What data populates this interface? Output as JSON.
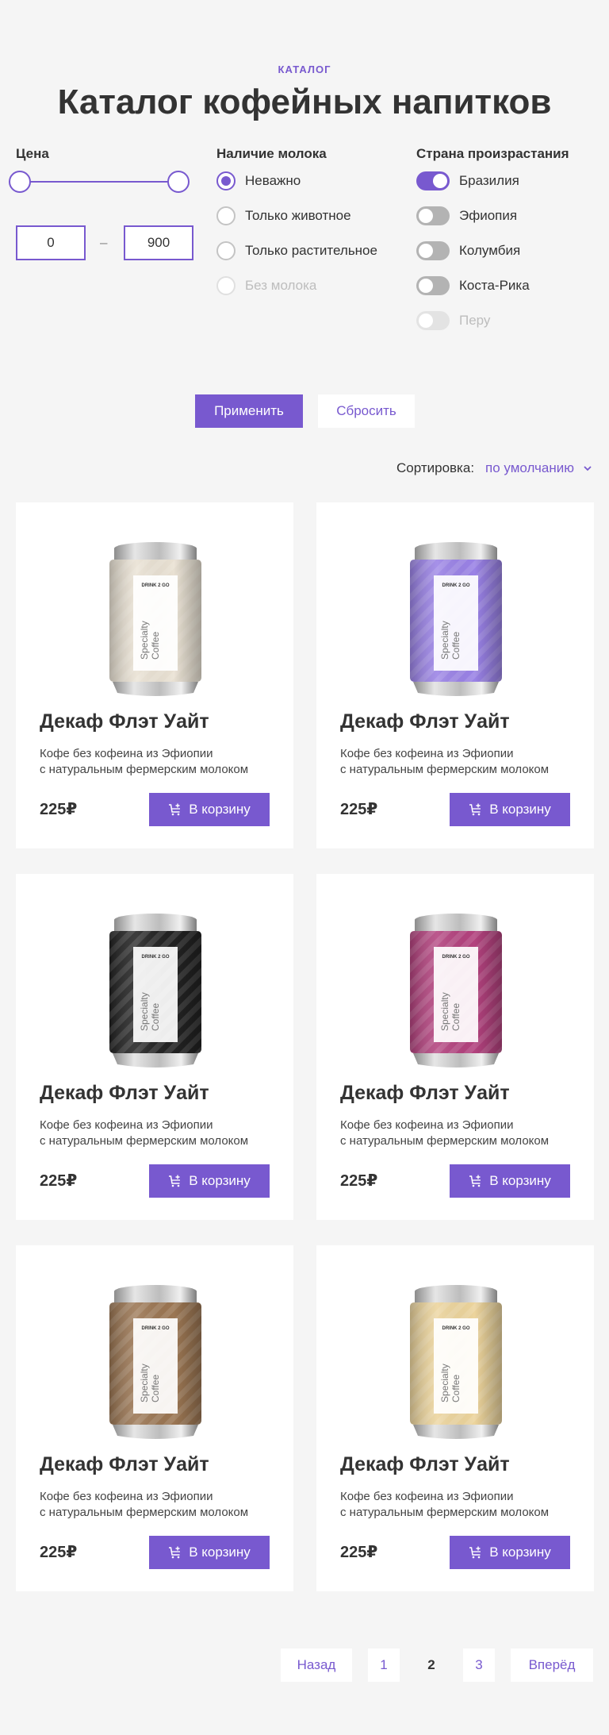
{
  "header": {
    "eyebrow": "КАТАЛОГ",
    "title": "Каталог кофейных напитков"
  },
  "filters": {
    "price": {
      "heading": "Цена",
      "min": "0",
      "max": "900",
      "separator": "–"
    },
    "milk": {
      "heading": "Наличие молока",
      "options": [
        {
          "label": "Неважно",
          "checked": true,
          "disabled": false
        },
        {
          "label": "Только животное",
          "checked": false,
          "disabled": false
        },
        {
          "label": "Только растительное",
          "checked": false,
          "disabled": false
        },
        {
          "label": "Без молока",
          "checked": false,
          "disabled": true
        }
      ]
    },
    "country": {
      "heading": "Страна произрастания",
      "options": [
        {
          "label": "Бразилия",
          "on": true,
          "disabled": false
        },
        {
          "label": "Эфиопия",
          "on": false,
          "disabled": false
        },
        {
          "label": "Колумбия",
          "on": false,
          "disabled": false
        },
        {
          "label": "Коста-Рика",
          "on": false,
          "disabled": false
        },
        {
          "label": "Перу",
          "on": false,
          "disabled": true
        }
      ]
    },
    "apply_label": "Применить",
    "reset_label": "Сбросить"
  },
  "sort": {
    "label": "Сортировка:",
    "value": "по умолчанию"
  },
  "products": [
    {
      "name": "Декаф Флэт Уайт",
      "desc_line1": "Кофе без кофеина из Эфиопии",
      "desc_line2": "с натуральным фермерским молоком",
      "price": "225₽",
      "button": "В корзину",
      "can_color": "#e9e1d3"
    },
    {
      "name": "Декаф Флэт Уайт",
      "desc_line1": "Кофе без кофеина из Эфиопии",
      "desc_line2": "с натуральным фермерским молоком",
      "price": "225₽",
      "button": "В корзину",
      "can_color": "#9a82e6"
    },
    {
      "name": "Декаф Флэт Уайт",
      "desc_line1": "Кофе без кофеина из Эфиопии",
      "desc_line2": "с натуральным фермерским молоком",
      "price": "225₽",
      "button": "В корзину",
      "can_color": "#222222"
    },
    {
      "name": "Декаф Флэт Уайт",
      "desc_line1": "Кофе без кофеина из Эфиопии",
      "desc_line2": "с натуральным фермерским молоком",
      "price": "225₽",
      "button": "В корзину",
      "can_color": "#b3427e"
    },
    {
      "name": "Декаф Флэт Уайт",
      "desc_line1": "Кофе без кофеина из Эфиопии",
      "desc_line2": "с натуральным фермерским молоком",
      "price": "225₽",
      "button": "В корзину",
      "can_color": "#9b7653"
    },
    {
      "name": "Декаф Флэт Уайт",
      "desc_line1": "Кофе без кофеина из Эфиопии",
      "desc_line2": "с натуральным фермерским молоком",
      "price": "225₽",
      "button": "В корзину",
      "can_color": "#ecd49c"
    }
  ],
  "can_label": {
    "brand": "DRINK 2 GO",
    "line1": "Specialty",
    "line2": "Coffee"
  },
  "pagination": {
    "prev": "Назад",
    "pages": [
      "1",
      "2",
      "3"
    ],
    "current": "2",
    "next": "Вперёд"
  },
  "colors": {
    "accent": "#7859cf",
    "background": "#f5f5f5",
    "text": "#333333"
  }
}
